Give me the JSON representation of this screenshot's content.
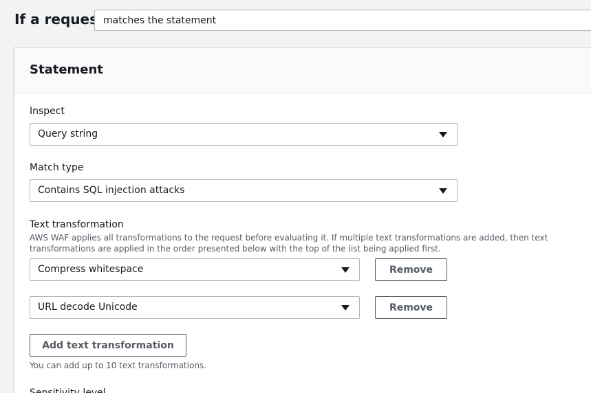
{
  "header": {
    "if_label": "If a request",
    "match_select_value": "matches the statement"
  },
  "statement": {
    "title": "Statement",
    "inspect": {
      "label": "Inspect",
      "value": "Query string"
    },
    "match_type": {
      "label": "Match type",
      "value": "Contains SQL injection attacks"
    },
    "text_transformation": {
      "label": "Text transformation",
      "description": "AWS WAF applies all transformations to the request before evaluating it. If multiple text transformations are added, then text transformations are applied in the order presented below with the top of the list being applied first.",
      "items": [
        {
          "value": "Compress whitespace",
          "remove_label": "Remove"
        },
        {
          "value": "URL decode Unicode",
          "remove_label": "Remove"
        }
      ],
      "add_label": "Add text transformation",
      "hint": "You can add up to 10 text transformations."
    },
    "sensitivity": {
      "label": "Sensitivity level"
    }
  }
}
